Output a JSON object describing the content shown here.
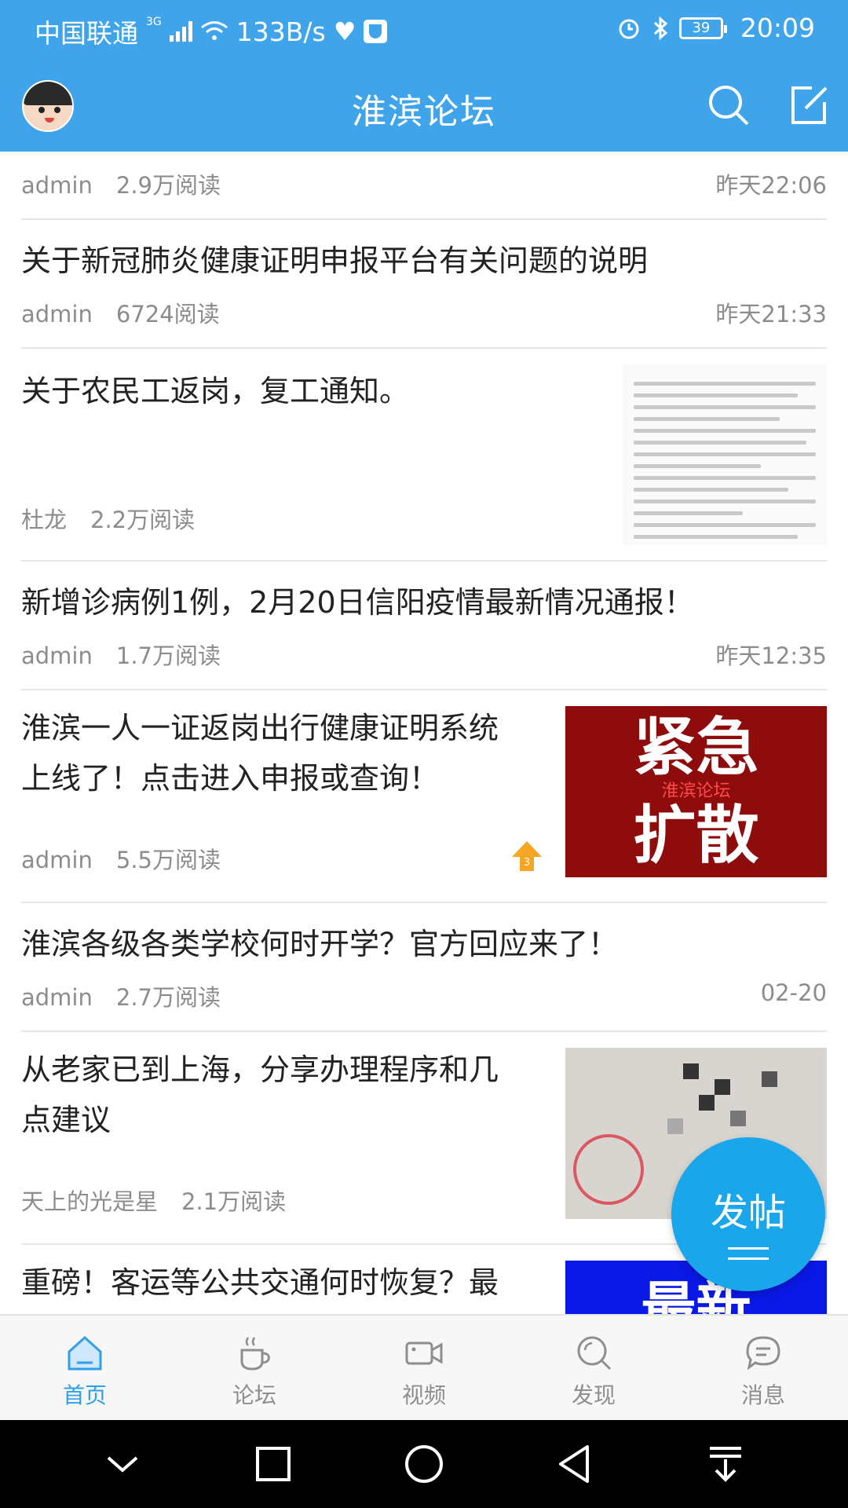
{
  "status_bar": {
    "carrier": "中国联通",
    "network": "3G",
    "speed": "133B/s",
    "battery": "39",
    "time": "20:09"
  },
  "header": {
    "title": "淮滨论坛",
    "bg_color": "#3fa4ea"
  },
  "feed": [
    {
      "title": "",
      "author": "admin",
      "reads": "2.9万阅读",
      "time": "昨天22:06"
    },
    {
      "title": "关于新冠肺炎健康证明申报平台有关问题的说明",
      "author": "admin",
      "reads": "6724阅读",
      "time": "昨天21:33"
    },
    {
      "title": "关于农民工返岗，复工通知。",
      "author": "杜龙",
      "reads": "2.2万阅读",
      "thumb": "document-scan"
    },
    {
      "title": "新增诊病例1例，2月20日信阳疫情最新情况通报！",
      "author": "admin",
      "reads": "1.7万阅读",
      "time": "昨天12:35"
    },
    {
      "title_line1": "淮滨一人一证返岗出行健康证明系统",
      "title_line2": "上线了！点击进入申报或查询！",
      "author": "admin",
      "reads": "5.5万阅读",
      "badge": "3",
      "thumb_text_top": "紧急",
      "thumb_watermark": "淮滨论坛",
      "thumb_text_bottom": "扩散"
    },
    {
      "title": "淮滨各级各类学校何时开学？官方回应来了！",
      "author": "admin",
      "reads": "2.7万阅读",
      "time": "02-20"
    },
    {
      "title_line1": "从老家已到上海，分享办理程序和几",
      "title_line2": "点建议",
      "author": "天上的光是星",
      "reads": "2.1万阅读",
      "thumb": "pixelated-document"
    },
    {
      "title": "重磅！客运等公共交通何时恢复？最",
      "thumb_text": "最新"
    }
  ],
  "fab": {
    "label": "发帖"
  },
  "bottom_nav": [
    {
      "label": "首页",
      "icon": "home-icon",
      "active": true
    },
    {
      "label": "论坛",
      "icon": "cup-icon"
    },
    {
      "label": "视频",
      "icon": "video-icon"
    },
    {
      "label": "发现",
      "icon": "discover-icon"
    },
    {
      "label": "消息",
      "icon": "message-icon"
    }
  ],
  "colors": {
    "accent": "#2f9fe8",
    "fab": "#19a6ea"
  }
}
